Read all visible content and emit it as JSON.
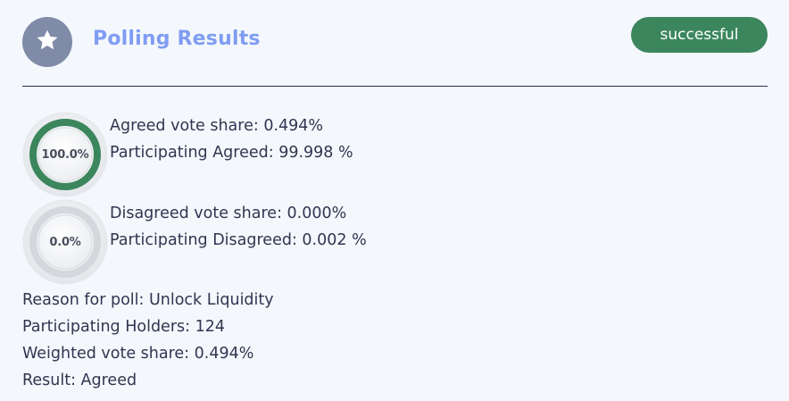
{
  "header": {
    "title": "Polling Results",
    "status": "successful",
    "icon": "star-icon"
  },
  "colors": {
    "accent": "#7f9df2",
    "success": "#3b865d",
    "avatar_bg": "#7f8ba7",
    "gauge_track": "#dfe2e6"
  },
  "agreed": {
    "percent_label": "100.0%",
    "fill_fraction": 1.0,
    "vote_share": "Agreed vote share: 0.494%",
    "participating": "Participating Agreed: 99.998 %"
  },
  "disagreed": {
    "percent_label": "0.0%",
    "fill_fraction": 0.0,
    "vote_share": "Disagreed vote share: 0.000%",
    "participating": "Participating Disagreed: 0.002 %"
  },
  "details": {
    "reason": "Reason for poll: Unlock Liquidity",
    "holders": "Participating Holders: 124",
    "weighted": "Weighted vote share: 0.494%",
    "result": "Result: Agreed"
  }
}
